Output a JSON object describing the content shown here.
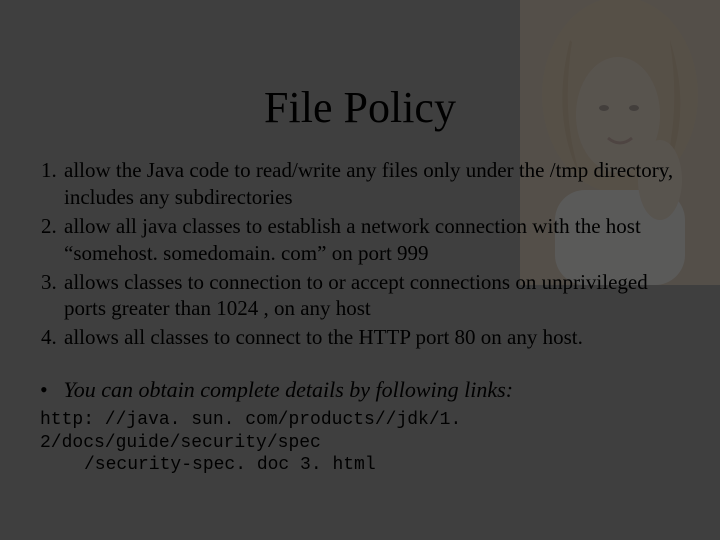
{
  "title": "File Policy",
  "items": [
    "allow the Java code to read/write any files only under the /tmp directory, includes any subdirectories",
    " allow all java classes to establish a network connection with the host “somehost. somedomain. com” on port 999",
    " allows classes to connection to or accept connections on unprivileged ports greater than 1024 , on any host",
    " allows all classes to connect to the HTTP port 80 on any host."
  ],
  "note": "You can obtain complete details by following links:",
  "link_line1": "http: //java. sun. com/products//jdk/1. 2/docs/guide/security/spec",
  "link_line2": "/security-spec. doc 3. html"
}
